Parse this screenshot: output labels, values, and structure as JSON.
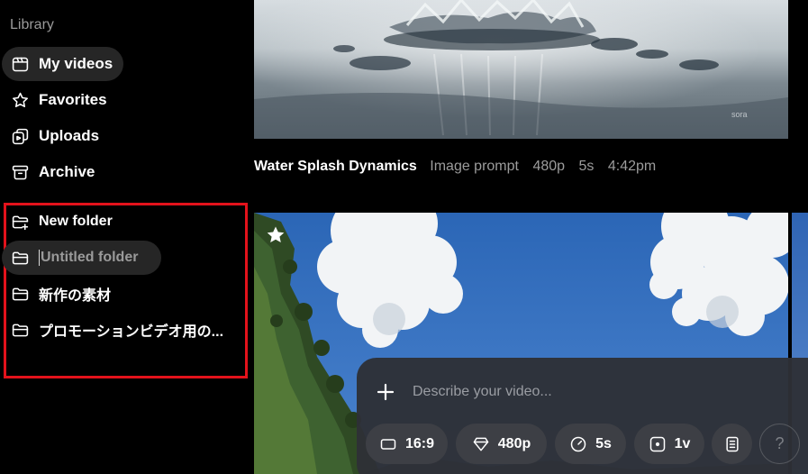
{
  "sidebar": {
    "section_title": "Library",
    "nav": [
      {
        "label": "My videos",
        "icon": "clapperboard-icon",
        "active": true
      },
      {
        "label": "Favorites",
        "icon": "star-icon"
      },
      {
        "label": "Uploads",
        "icon": "uploads-icon"
      },
      {
        "label": "Archive",
        "icon": "archive-icon"
      }
    ],
    "folders": [
      {
        "label": "New folder",
        "icon": "folder-plus-icon"
      },
      {
        "label": "Untitled folder",
        "icon": "folder-icon",
        "editing": true
      },
      {
        "label": "新作の素材",
        "icon": "folder-icon"
      },
      {
        "label": "プロモーションビデオ用の...",
        "icon": "folder-icon"
      }
    ],
    "highlight_color": "#e3121b"
  },
  "videos": [
    {
      "title": "Water Splash Dynamics",
      "source": "Image prompt",
      "resolution": "480p",
      "duration": "5s",
      "time": "4:42pm",
      "watermark": "sora"
    },
    {
      "favorited": true
    }
  ],
  "composer": {
    "add_label": "+",
    "placeholder": "Describe your video...",
    "chips": {
      "aspect": "16:9",
      "resolution": "480p",
      "duration": "5s",
      "variations": "1v",
      "help": "?"
    }
  }
}
